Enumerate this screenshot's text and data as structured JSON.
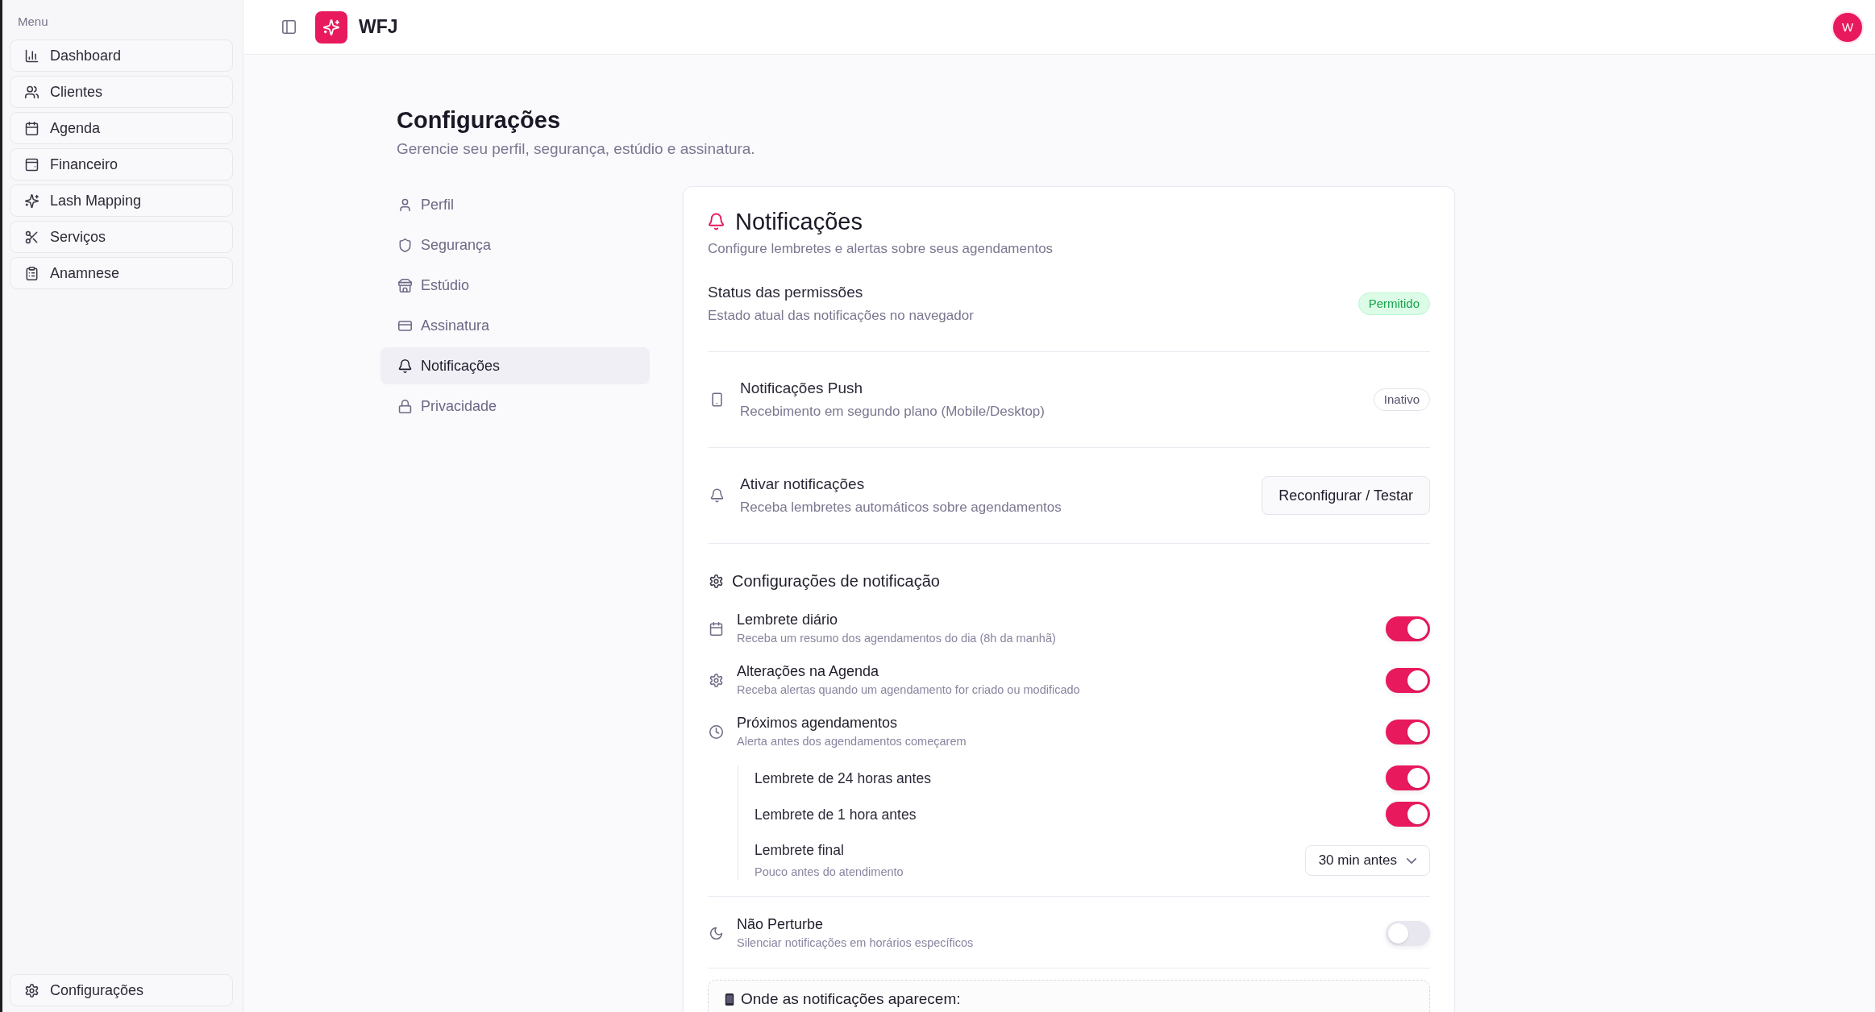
{
  "sidebar": {
    "heading": "Menu",
    "items": [
      {
        "label": "Dashboard"
      },
      {
        "label": "Clientes"
      },
      {
        "label": "Agenda"
      },
      {
        "label": "Financeiro"
      },
      {
        "label": "Lash Mapping"
      },
      {
        "label": "Serviços"
      },
      {
        "label": "Anamnese"
      }
    ],
    "footer_item": {
      "label": "Configurações"
    }
  },
  "header": {
    "app_name": "WFJ",
    "avatar_initial": "W"
  },
  "page": {
    "title": "Configurações",
    "subtitle": "Gerencie seu perfil, segurança, estúdio e assinatura."
  },
  "settings_nav": [
    {
      "label": "Perfil",
      "selected": false
    },
    {
      "label": "Segurança",
      "selected": false
    },
    {
      "label": "Estúdio",
      "selected": false
    },
    {
      "label": "Assinatura",
      "selected": false
    },
    {
      "label": "Notificações",
      "selected": true
    },
    {
      "label": "Privacidade",
      "selected": false
    }
  ],
  "card": {
    "title": "Notificações",
    "subtitle": "Configure lembretes e alertas sobre seus agendamentos",
    "permission_status": {
      "title": "Status das permissões",
      "description": "Estado atual das notificações no navegador",
      "badge": "Permitido"
    },
    "push": {
      "title": "Notificações Push",
      "description": "Recebimento em segundo plano (Mobile/Desktop)",
      "badge": "Inativo"
    },
    "activate": {
      "title": "Ativar notificações",
      "description": "Receba lembretes automáticos sobre agendamentos",
      "button": "Reconfigurar / Testar"
    },
    "preferences": {
      "heading": "Configurações de notificação",
      "items": [
        {
          "title": "Lembrete diário",
          "description": "Receba um resumo dos agendamentos do dia (8h da manhã)",
          "on": true
        },
        {
          "title": "Alterações na Agenda",
          "description": "Receba alertas quando um agendamento for criado ou modificado",
          "on": true
        },
        {
          "title": "Próximos agendamentos",
          "description": "Alerta antes dos agendamentos começarem",
          "on": true,
          "children": [
            {
              "kind": "toggle",
              "title": "Lembrete de 24 horas antes",
              "on": true
            },
            {
              "kind": "toggle",
              "title": "Lembrete de 1 hora antes",
              "on": true
            },
            {
              "kind": "select",
              "title": "Lembrete final",
              "description": "Pouco antes do atendimento",
              "value": "30 min antes"
            }
          ]
        }
      ]
    },
    "do_not_disturb": {
      "title": "Não Perturbe",
      "description": "Silenciar notificações em horários específicos",
      "on": false
    },
    "where_shown": {
      "heading": "Onde as notificações aparecem:"
    }
  }
}
